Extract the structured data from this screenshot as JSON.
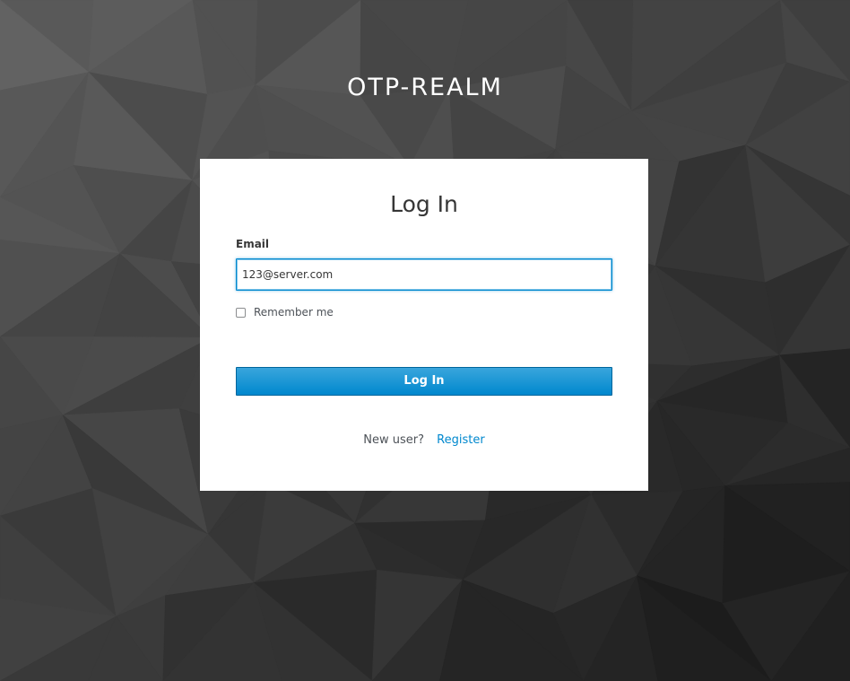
{
  "realm": {
    "title": "OTP-REALM"
  },
  "login_card": {
    "heading": "Log In",
    "email": {
      "label": "Email",
      "value": "123@server.com"
    },
    "remember_me": {
      "label": "Remember me",
      "checked": false
    },
    "submit_label": "Log In",
    "new_user_text": "New user?",
    "register_label": "Register"
  },
  "colors": {
    "accent": "#0088ce",
    "background": "#3a3a3a",
    "card": "#ffffff"
  }
}
